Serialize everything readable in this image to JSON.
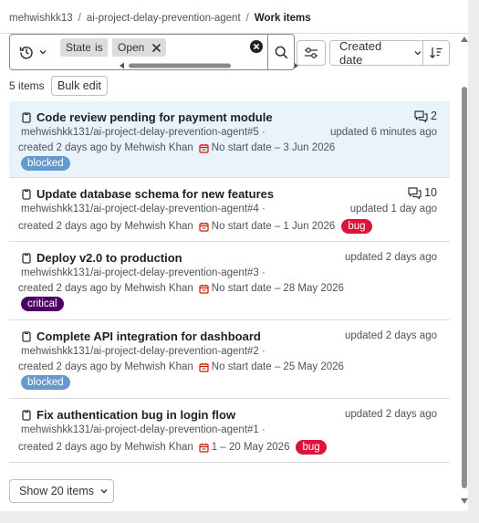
{
  "breadcrumb": {
    "items": [
      "mehwishkk13",
      "ai-project-delay-prevention-agent"
    ],
    "current": "Work items"
  },
  "filter_bar": {
    "history_icon": "history-icon",
    "token_field": "State",
    "token_operator": "is",
    "token_value": "Open",
    "sort_label": "Created date"
  },
  "list_header": {
    "count_label": "5 items",
    "bulk_edit_label": "Bulk edit"
  },
  "items": [
    {
      "title": "Code review pending for payment module",
      "ref": "mehwishkk131/ai-project-delay-prevention-agent#5 ·",
      "created": "created 2 days ago by Mehwish Khan",
      "dates": "No start date – 3 Jun 2026",
      "updated": "updated 6 minutes ago",
      "comments": "2",
      "label": "blocked",
      "label_color": "#6699cc",
      "highlighted": true
    },
    {
      "title": "Update database schema for new features",
      "ref": "mehwishkk131/ai-project-delay-prevention-agent#4 ·",
      "created": "created 2 days ago by Mehwish Khan",
      "dates": "No start date – 1 Jun 2026",
      "updated": "updated 1 day ago",
      "comments": "10",
      "label": "bug",
      "label_color": "#dc143c",
      "highlighted": false
    },
    {
      "title": "Deploy v2.0 to production",
      "ref": "mehwishkk131/ai-project-delay-prevention-agent#3 ·",
      "created": "created 2 days ago by Mehwish Khan",
      "dates": "No start date – 28 May 2026",
      "updated": "updated 2 days ago",
      "comments": "",
      "label": "critical",
      "label_color": "#4d0066",
      "highlighted": false
    },
    {
      "title": "Complete API integration for dashboard",
      "ref": "mehwishkk131/ai-project-delay-prevention-agent#2 ·",
      "created": "created 2 days ago by Mehwish Khan",
      "dates": "No start date – 25 May 2026",
      "updated": "updated 2 days ago",
      "comments": "",
      "label": "blocked",
      "label_color": "#6699cc",
      "highlighted": false
    },
    {
      "title": "Fix authentication bug in login flow",
      "ref": "mehwishkk131/ai-project-delay-prevention-agent#1 ·",
      "created": "created 2 days ago by Mehwish Khan",
      "dates": "1 – 20 May 2026",
      "updated": "updated 2 days ago",
      "comments": "",
      "label": "bug",
      "label_color": "#dc143c",
      "highlighted": false
    }
  ],
  "pagination": {
    "show_label": "Show 20 items"
  },
  "colors": {
    "highlight_bg": "#e9f3fc",
    "calendar_icon": "#c91c00"
  }
}
